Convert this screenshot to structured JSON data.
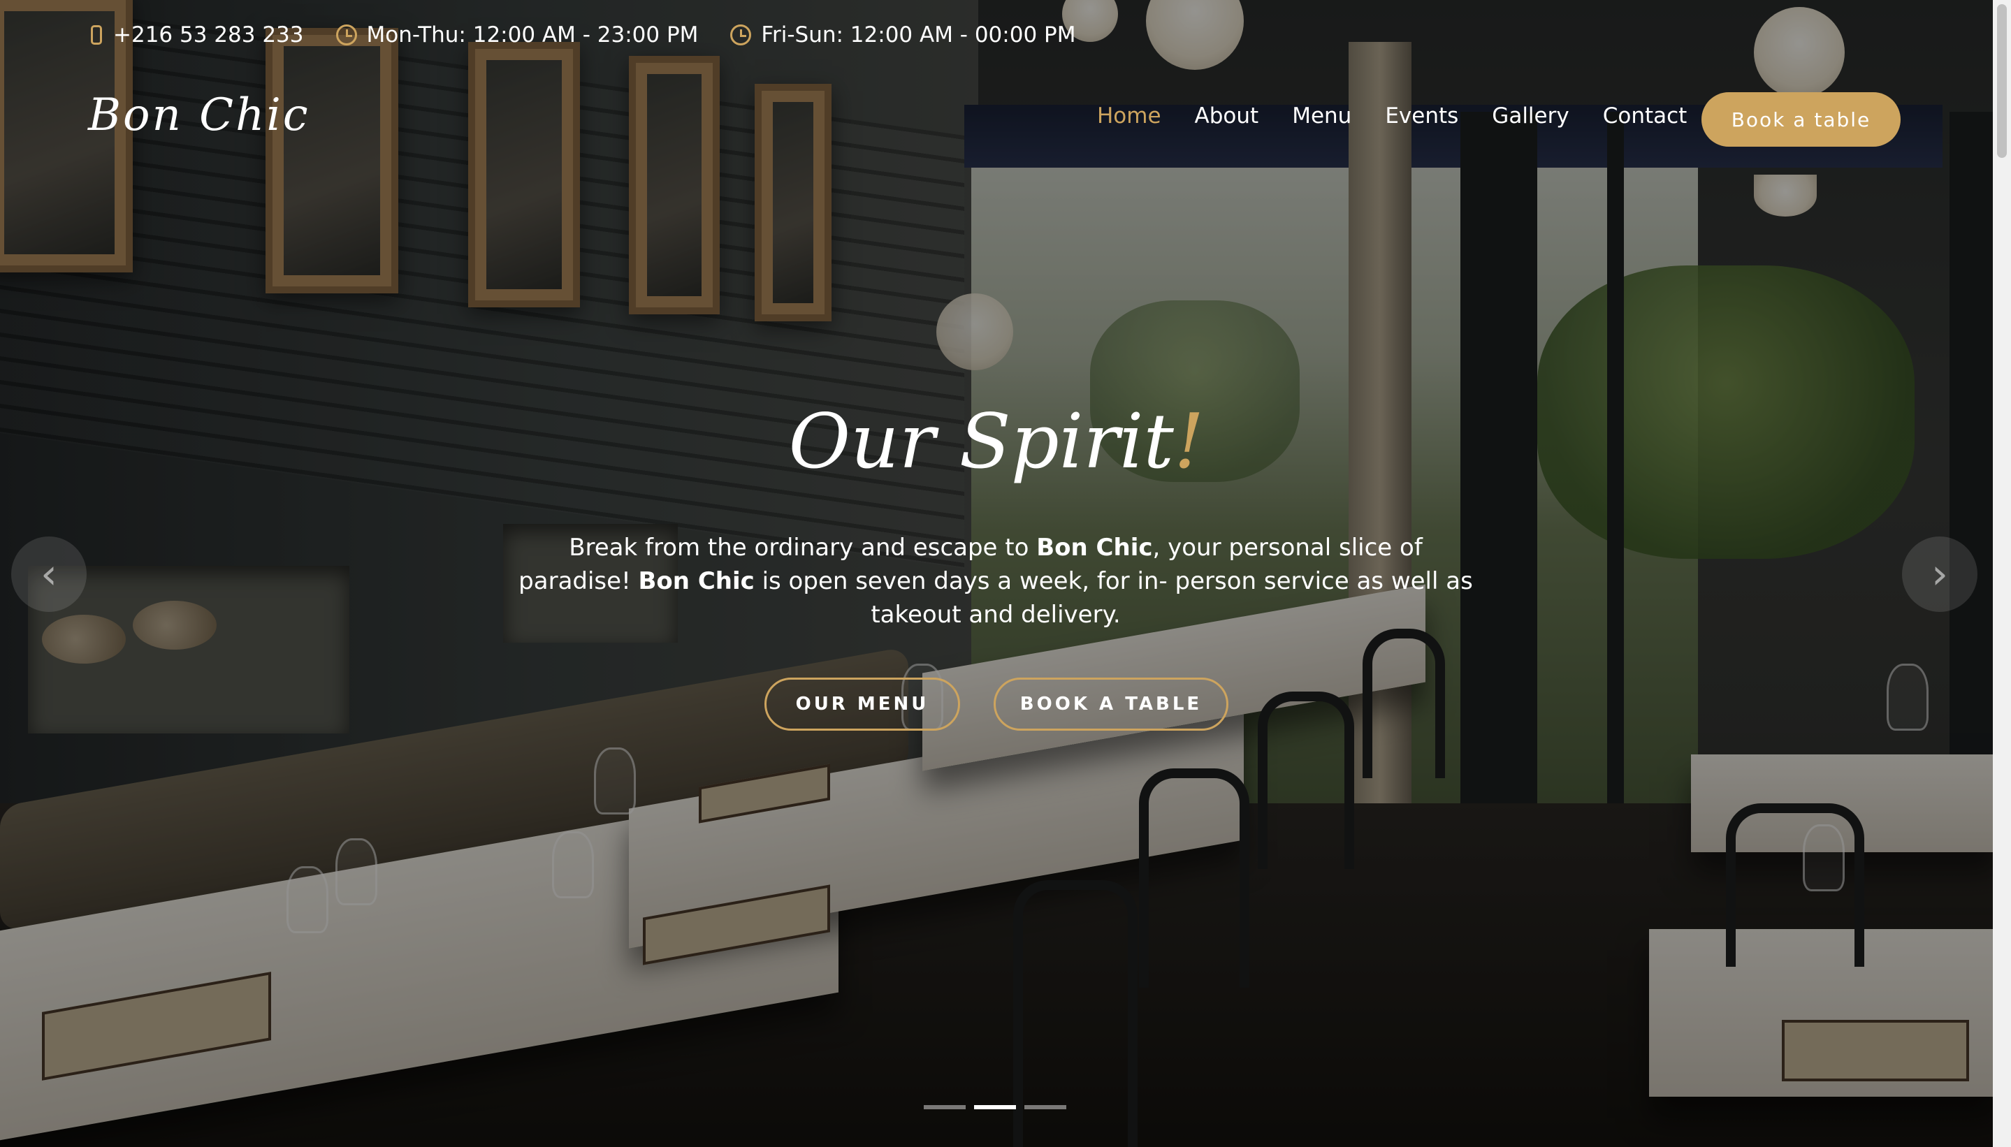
{
  "topbar": {
    "phone": "+216 53 283 233",
    "hours_weekday": "Mon-Thu: 12:00 AM - 23:00 PM",
    "hours_weekend": "Fri-Sun: 12:00 AM - 00:00 PM"
  },
  "header": {
    "logo": "Bon Chic",
    "nav": [
      {
        "label": "Home",
        "active": true
      },
      {
        "label": "About",
        "active": false
      },
      {
        "label": "Menu",
        "active": false
      },
      {
        "label": "Events",
        "active": false
      },
      {
        "label": "Gallery",
        "active": false
      },
      {
        "label": "Contact",
        "active": false
      }
    ],
    "cta": "Book a table"
  },
  "hero": {
    "title": "Our Spirit",
    "title_accent": "!",
    "desc_1": "Break from the ordinary and escape to ",
    "desc_bold_1": "Bon Chic",
    "desc_2": ", your personal slice of paradise! ",
    "desc_bold_2": "Bon Chic",
    "desc_3": " is open seven days a week, for in- person service as well as takeout and delivery.",
    "btn_menu": "OUR MENU",
    "btn_book": "BOOK A TABLE",
    "arrow_prev": "‹",
    "arrow_next": "›",
    "slide_count": 3,
    "active_slide": 2
  },
  "colors": {
    "accent": "#cda45e",
    "text": "#ffffff"
  },
  "icons": {
    "phone": "phone-icon",
    "clock": "clock-icon",
    "prev": "chevron-left-icon",
    "next": "chevron-right-icon"
  }
}
